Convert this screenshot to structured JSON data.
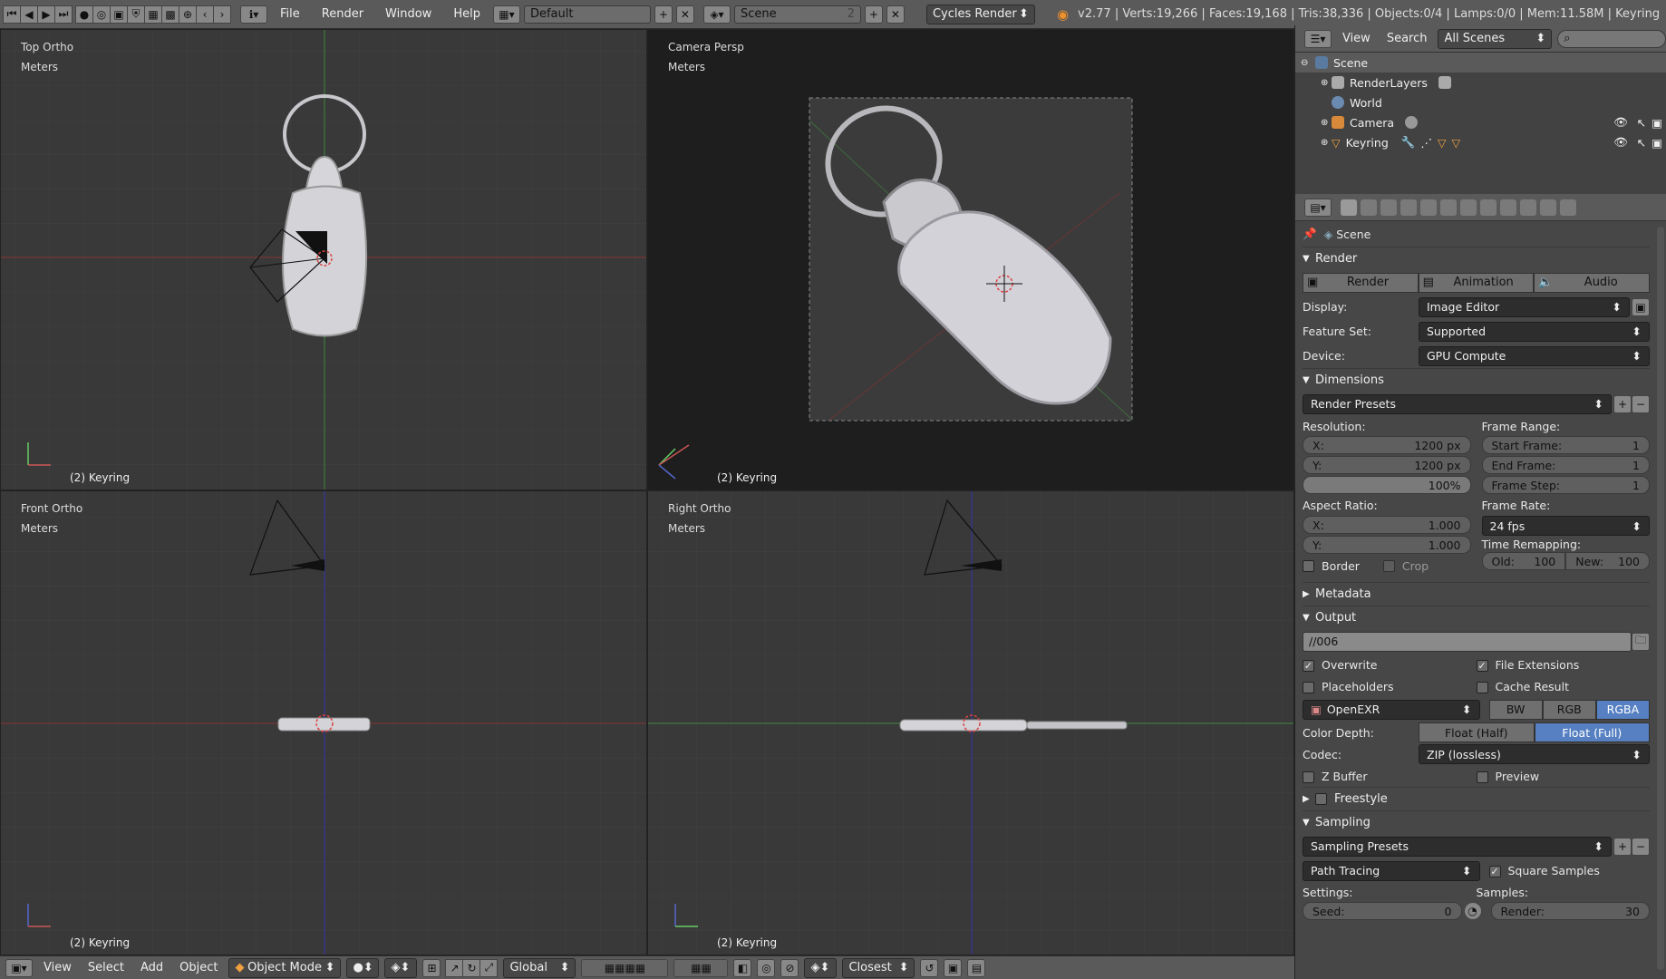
{
  "topbar": {
    "menus": [
      "File",
      "Render",
      "Window",
      "Help"
    ],
    "screen_layout": "Default",
    "scene_name": "Scene",
    "scene_users": "2",
    "render_engine": "Cycles Render",
    "stats": "v2.77 | Verts:19,266 | Faces:19,168 | Tris:38,336 | Objects:0/4 | Lamps:0/0 | Mem:11.58M | Keyring"
  },
  "viewports": {
    "top": {
      "view": "Top Ortho",
      "units": "Meters",
      "object": "(2) Keyring"
    },
    "camera": {
      "view": "Camera Persp",
      "units": "Meters",
      "object": "(2) Keyring"
    },
    "front": {
      "view": "Front Ortho",
      "units": "Meters",
      "object": "(2) Keyring"
    },
    "right": {
      "view": "Right Ortho",
      "units": "Meters",
      "object": "(2) Keyring"
    }
  },
  "bottombar": {
    "menus": [
      "View",
      "Select",
      "Add",
      "Object"
    ],
    "mode": "Object Mode",
    "orientation": "Global",
    "snap": "Closest"
  },
  "outliner": {
    "menus": [
      "View",
      "Search"
    ],
    "filter": "All Scenes",
    "items": [
      {
        "label": "Scene"
      },
      {
        "label": "RenderLayers"
      },
      {
        "label": "World"
      },
      {
        "label": "Camera"
      },
      {
        "label": "Keyring"
      }
    ]
  },
  "properties": {
    "context": "Scene",
    "render": {
      "header": "Render",
      "buttons": [
        "Render",
        "Animation",
        "Audio"
      ],
      "display_label": "Display:",
      "display_value": "Image Editor",
      "feature_label": "Feature Set:",
      "feature_value": "Supported",
      "device_label": "Device:",
      "device_value": "GPU Compute"
    },
    "dimensions": {
      "header": "Dimensions",
      "presets": "Render Presets",
      "resolution_label": "Resolution:",
      "res_x_label": "X:",
      "res_x": "1200 px",
      "res_y_label": "Y:",
      "res_y": "1200 px",
      "res_pct": "100%",
      "frame_range_label": "Frame Range:",
      "start_label": "Start Frame:",
      "start": "1",
      "end_label": "End Frame:",
      "end": "1",
      "step_label": "Frame Step:",
      "step": "1",
      "aspect_label": "Aspect Ratio:",
      "asp_x_label": "X:",
      "asp_x": "1.000",
      "asp_y_label": "Y:",
      "asp_y": "1.000",
      "frame_rate_label": "Frame Rate:",
      "frame_rate": "24 fps",
      "time_remap_label": "Time Remapping:",
      "old_label": "Old:",
      "old": "100",
      "new_label": "New:",
      "new": "100",
      "border": "Border",
      "crop": "Crop"
    },
    "metadata_header": "Metadata",
    "output": {
      "header": "Output",
      "path": "//006",
      "overwrite": "Overwrite",
      "file_ext": "File Extensions",
      "placeholders": "Placeholders",
      "cache": "Cache Result",
      "format": "OpenEXR",
      "modes": [
        "BW",
        "RGB",
        "RGBA"
      ],
      "color_depth_label": "Color Depth:",
      "depths": [
        "Float (Half)",
        "Float (Full)"
      ],
      "codec_label": "Codec:",
      "codec": "ZIP (lossless)",
      "zbuffer": "Z Buffer",
      "preview": "Preview"
    },
    "freestyle_header": "Freestyle",
    "sampling": {
      "header": "Sampling",
      "presets": "Sampling Presets",
      "integrator": "Path Tracing",
      "square": "Square Samples",
      "settings_label": "Settings:",
      "samples_label": "Samples:",
      "seed_label": "Seed:",
      "seed": "0",
      "render_label": "Render:",
      "render": "30"
    }
  }
}
